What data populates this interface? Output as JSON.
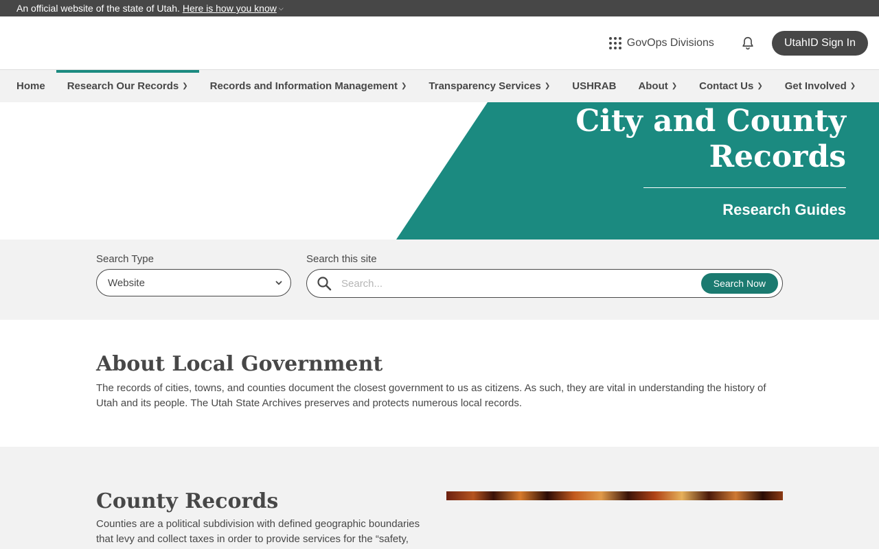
{
  "util_bar": {
    "text": "An official website of the state of Utah.",
    "link": "Here is how you know"
  },
  "header": {
    "divisions": "GovOps Divisions",
    "signin": "UtahID Sign In"
  },
  "nav": {
    "items": [
      {
        "label": "Home",
        "dropdown": false
      },
      {
        "label": "Research Our Records",
        "dropdown": true
      },
      {
        "label": "Records and Information Management",
        "dropdown": true
      },
      {
        "label": "Transparency Services",
        "dropdown": true
      },
      {
        "label": "USHRAB",
        "dropdown": false
      },
      {
        "label": "About",
        "dropdown": true
      },
      {
        "label": "Contact Us",
        "dropdown": true
      },
      {
        "label": "Get Involved",
        "dropdown": true
      }
    ],
    "active": "Research Our Records"
  },
  "hero": {
    "title_line1": "City and County",
    "title_line2": "Records",
    "subtitle": "Research Guides"
  },
  "search": {
    "type_label": "Search Type",
    "type_value": "Website",
    "site_label": "Search this site",
    "placeholder": "Search...",
    "button": "Search Now"
  },
  "about": {
    "heading": "About Local Government",
    "text_line1": "The records of cities, towns, and counties document the closest government to us as citizens. As such, they are vital in understanding the history of",
    "text_line2": "Utah and its people. The Utah State Archives preserves and protects numerous local records."
  },
  "county": {
    "heading": "County Records",
    "text_line1": "Counties are a political subdivision with defined geographic boundaries",
    "text_line2": "that levy and collect taxes in order to provide services for the “safety,"
  },
  "colors": {
    "accent": "#1b8a80",
    "dark": "#474747",
    "light_bg": "#f2f2f2"
  }
}
